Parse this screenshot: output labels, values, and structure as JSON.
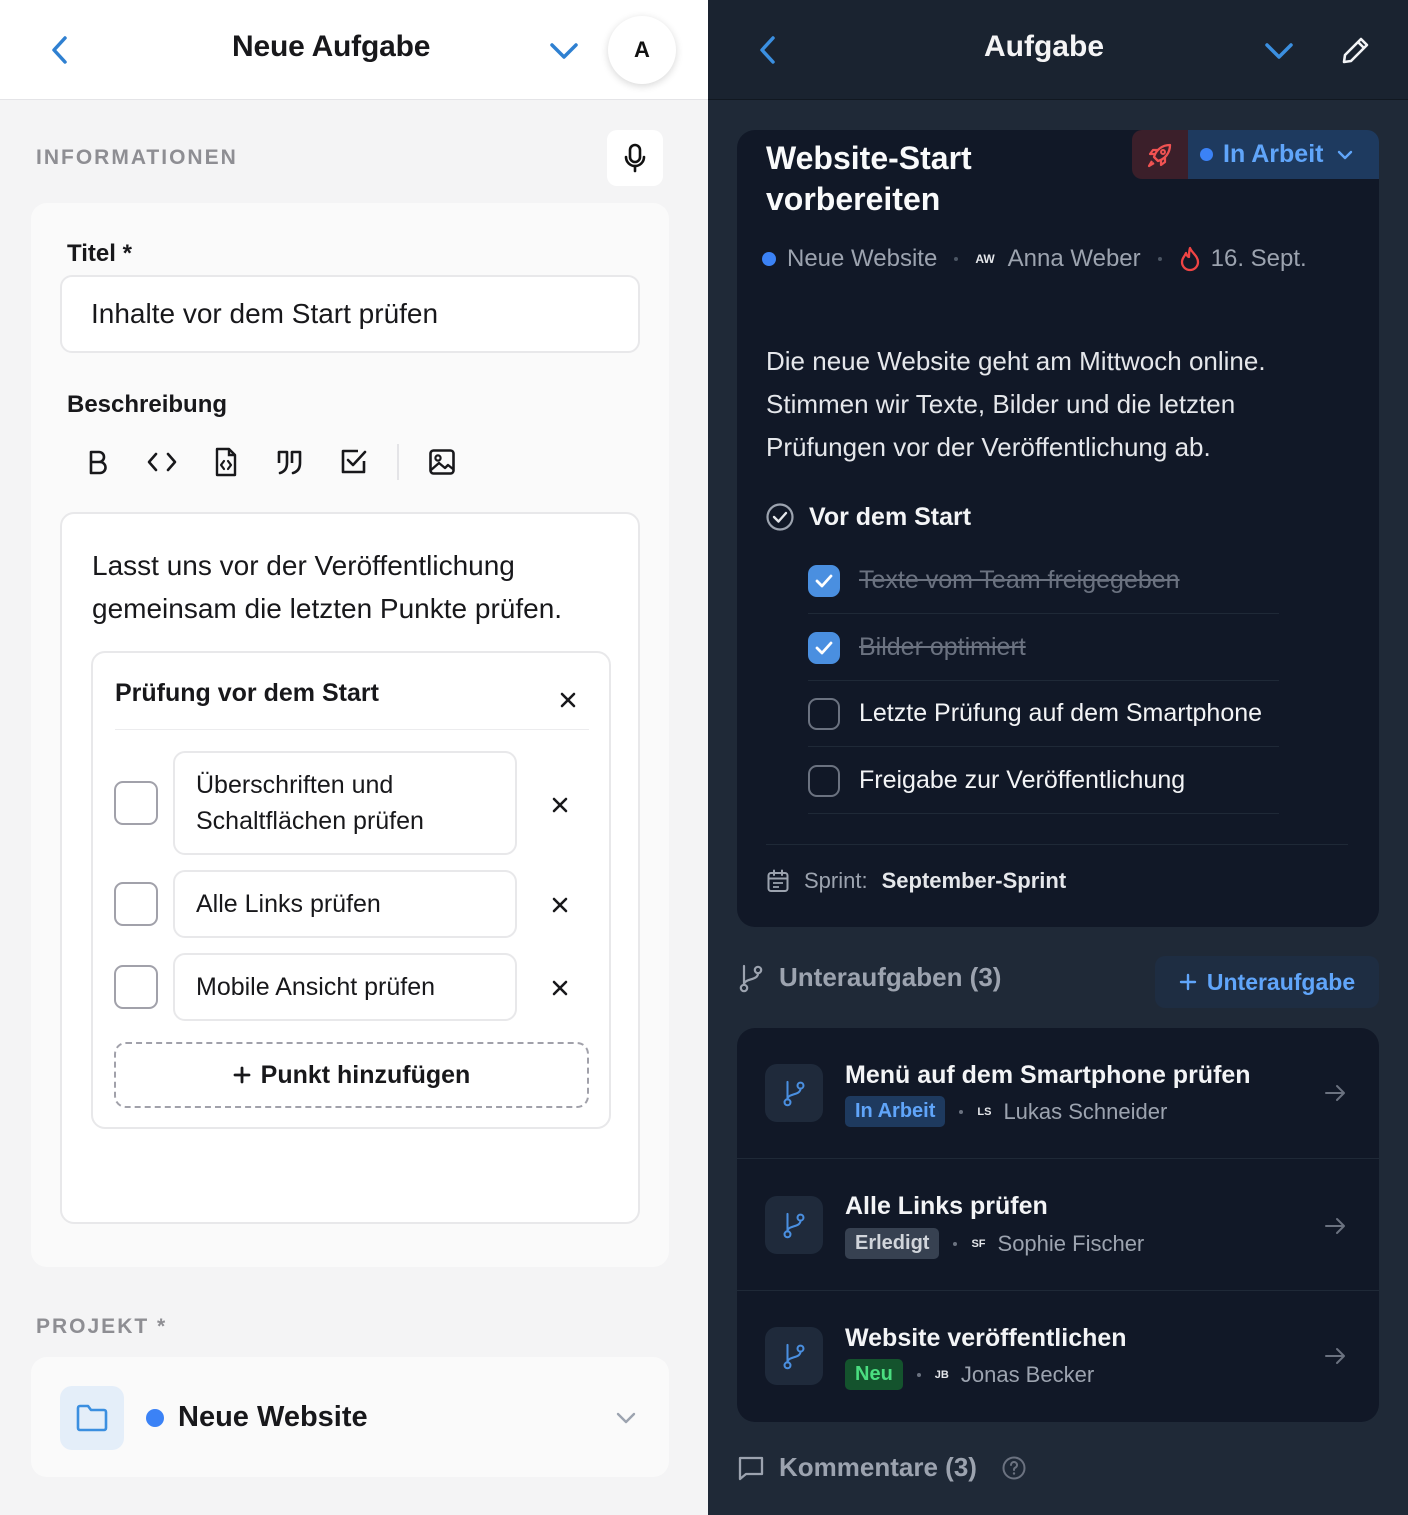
{
  "left": {
    "header": {
      "title": "Neue Aufgabe",
      "avatar_initial": "A"
    },
    "section_info": "INFORMATIONEN",
    "title_label": "Titel *",
    "title_value": "Inhalte vor dem Start prüfen",
    "description_label": "Beschreibung",
    "toolbar": [
      "bold-icon",
      "code-icon",
      "code-file-icon",
      "quote-icon",
      "checkbox-icon",
      "image-icon"
    ],
    "editor_text": "Lasst uns vor der Veröffentlichung gemeinsam die letzten Punkte prüfen.",
    "checklist": {
      "title": "Prüfung vor dem Start",
      "items": [
        {
          "label": "Überschriften und Schaltflächen prüfen",
          "checked": false
        },
        {
          "label": "Alle Links prüfen",
          "checked": false
        },
        {
          "label": "Mobile Ansicht prüfen",
          "checked": false
        }
      ],
      "add_label": "Punkt hinzufügen"
    },
    "section_project": "PROJEKT *",
    "project": {
      "name": "Neue Website",
      "color": "#3b82f6"
    }
  },
  "right": {
    "header": {
      "title": "Aufgabe"
    },
    "task": {
      "title": "Website-Start vorbereiten",
      "status": "In Arbeit",
      "project": "Neue Website",
      "assignee_initials": "AW",
      "assignee": "Anna Weber",
      "due": "16. Sept.",
      "description": "Die neue Website geht am Mittwoch online. Stimmen wir Texte, Bilder und die letzten Prüfungen vor der Veröffentlichung ab.",
      "checklist_title": "Vor dem Start",
      "checklist": [
        {
          "label": "Texte vom Team freigegeben",
          "checked": true
        },
        {
          "label": "Bilder optimiert",
          "checked": true
        },
        {
          "label": "Letzte Prüfung auf dem Smartphone",
          "checked": false
        },
        {
          "label": "Freigabe zur Veröffentlichung",
          "checked": false
        }
      ],
      "sprint_label": "Sprint:",
      "sprint_value": "September-Sprint"
    },
    "subtasks_heading": "Unteraufgaben (3)",
    "add_subtask": "Unteraufgabe",
    "subtasks": [
      {
        "title": "Menü auf dem Smartphone prüfen",
        "status": "In Arbeit",
        "initials": "LS",
        "assignee": "Lukas Schneider"
      },
      {
        "title": "Alle Links prüfen",
        "status": "Erledigt",
        "initials": "SF",
        "assignee": "Sophie Fischer"
      },
      {
        "title": "Website veröffentlichen",
        "status": "Neu",
        "initials": "JB",
        "assignee": "Jonas Becker"
      }
    ],
    "comments_heading": "Kommentare (3)"
  },
  "colors": {
    "accent": "#3b82f6",
    "dark_bg": "#1f2937",
    "card_bg": "#111827"
  }
}
